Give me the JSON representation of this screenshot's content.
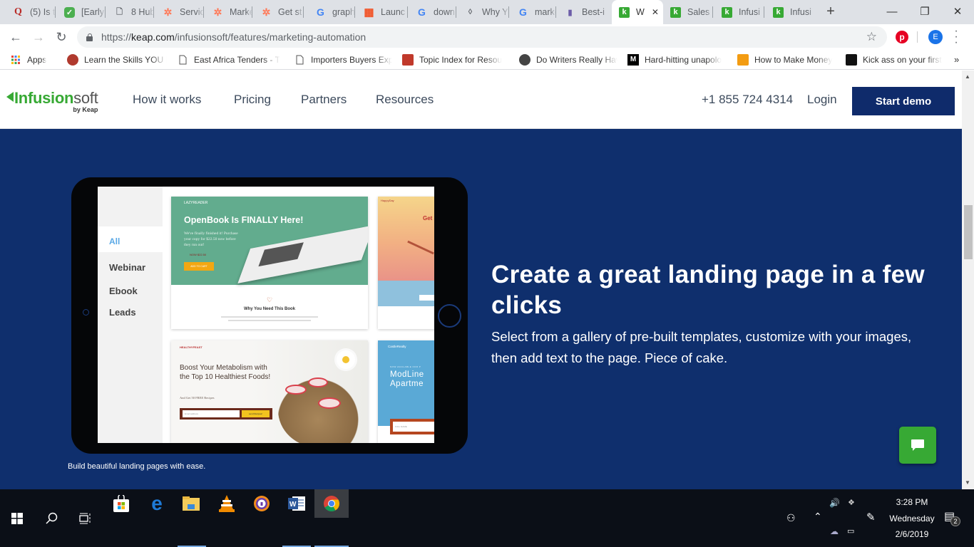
{
  "browser": {
    "tabs": [
      {
        "title": "(5) Is t",
        "icon": "quora-icon",
        "glyph": "Q"
      },
      {
        "title": "[Early",
        "icon": "app-icon",
        "glyph": "✓"
      },
      {
        "title": "8 Hub",
        "icon": "page-icon",
        "glyph": "🗋"
      },
      {
        "title": "Servic",
        "icon": "hubspot-icon",
        "glyph": "✲"
      },
      {
        "title": "Marke",
        "icon": "hubspot-icon",
        "glyph": "✲"
      },
      {
        "title": "Get st",
        "icon": "hubspot-icon",
        "glyph": "✲"
      },
      {
        "title": "graph",
        "icon": "google-icon",
        "glyph": "G"
      },
      {
        "title": "Launc",
        "icon": "microsoft-icon",
        "glyph": "▦"
      },
      {
        "title": "down",
        "icon": "google-icon",
        "glyph": "G"
      },
      {
        "title": "Why Y",
        "icon": "medium-icon",
        "glyph": "◊"
      },
      {
        "title": "marke",
        "icon": "google-icon",
        "glyph": "G"
      },
      {
        "title": "Best-i",
        "icon": "bars-icon",
        "glyph": "▮"
      },
      {
        "title": "W",
        "icon": "keap-icon",
        "glyph": "k",
        "active": true
      },
      {
        "title": "Sales",
        "icon": "keap-icon",
        "glyph": "k"
      },
      {
        "title": "Infusi",
        "icon": "keap-icon",
        "glyph": "k"
      },
      {
        "title": "Infusi",
        "icon": "keap-icon",
        "glyph": "k"
      }
    ],
    "new_tab": "+",
    "window_controls": {
      "minimize": "—",
      "maximize": "❐",
      "close": "✕"
    },
    "url": {
      "scheme": "https://",
      "host": "keap.com",
      "path": "/infusionsoft/features/marketing-automation"
    },
    "profile_initial": "E",
    "bookmarks": [
      {
        "label": "Apps",
        "icon": "apps-grid-icon"
      },
      {
        "label": "Learn the Skills YOU N",
        "icon": "site-icon"
      },
      {
        "label": "East Africa Tenders - T",
        "icon": "page-icon"
      },
      {
        "label": "Importers Buyers Exp",
        "icon": "page-icon"
      },
      {
        "label": "Topic Index for Resou",
        "icon": "site-icon"
      },
      {
        "label": "Do Writers Really Hav",
        "icon": "site-icon"
      },
      {
        "label": "Hard-hitting unapolo",
        "icon": "medium-m-icon"
      },
      {
        "label": "How to Make Money",
        "icon": "site-icon"
      },
      {
        "label": "Kick ass on your first",
        "icon": "site-icon"
      }
    ],
    "bookmarks_overflow": "»"
  },
  "site": {
    "logo": {
      "brand": "Infusion",
      "brand2": "soft",
      "tagline": "by Keap"
    },
    "nav": [
      "How it works",
      "Pricing",
      "Partners",
      "Resources"
    ],
    "phone": "+1 855 724 4314",
    "login": "Login",
    "cta": "Start demo",
    "colors": {
      "navy": "#0f2f6d",
      "green": "#37a934",
      "button": "#0f2b6b"
    }
  },
  "hero": {
    "heading": "Create a great landing page in a few clicks",
    "body": "Select from a gallery of pre-built templates, customize with your images, then add text to the page. Piece of cake.",
    "caption": "Build beautiful landing pages with ease.",
    "tablet": {
      "filters": [
        "All",
        "Webinar",
        "Ebook",
        "Leads"
      ],
      "selected_filter": "All",
      "templates": {
        "openbook": {
          "brand": "LAZYREADER",
          "title": "OpenBook Is FINALLY Here!",
          "body": "We've finally finished it! Purchase your copy for $22.50 now before they run out!",
          "price": "NOW $22.50",
          "button": "ADD TO CART",
          "section": "Why You Need This Book"
        },
        "metabolism": {
          "brand": "HEALTHYFEAST",
          "title": "Boost Your Metabolism with the Top 10 Healthiest Foods!",
          "sub": "And Get 50 FREE Recipes",
          "input_placeholder": "Email address",
          "button": "send Recipes!"
        },
        "happy": {
          "brand": "HappyDay",
          "title": "Get S"
        },
        "realty": {
          "brand": "CastleRealty",
          "kicker": "NOW AVAILABLE FOR P",
          "title": "ModLine Apartme",
          "input_placeholder": "FULL NAME"
        }
      }
    }
  },
  "taskbar": {
    "apps": [
      "start",
      "search",
      "task-view",
      "store",
      "edge",
      "file-explorer",
      "vlc",
      "avast-browser",
      "word",
      "chrome"
    ],
    "time": "3:28 PM",
    "day": "Wednesday",
    "date": "2/6/2019",
    "notifications": "2"
  }
}
